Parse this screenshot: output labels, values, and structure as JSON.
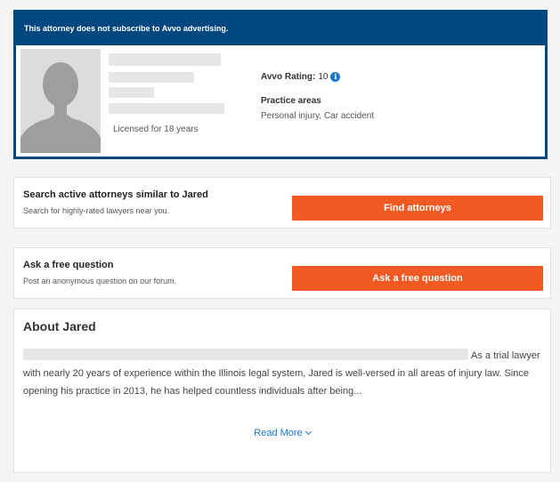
{
  "profile": {
    "ad_banner": "This attorney does not subscribe to Avvo advertising.",
    "licensed": "Licensed for 18 years",
    "rating_label": "Avvo Rating:",
    "rating_value": "10",
    "info_glyph": "i",
    "practice_areas_title": "Practice areas",
    "practice_areas": "Personal injury, Car accident"
  },
  "similar": {
    "title": "Search active attorneys similar to Jared",
    "subtitle": "Search for highly-rated lawyers near you.",
    "button": "Find attorneys"
  },
  "question": {
    "title": "Ask a free question",
    "subtitle": "Post an anonymous question on our forum.",
    "button": "Ask a free question"
  },
  "about": {
    "title": "About Jared",
    "text": "As a trial lawyer with nearly 20 years of experience within the Illinois legal system, Jared is well-versed in all areas of injury law. Since opening his practice in 2013, he has helped countless individuals after being...",
    "read_more": "Read More"
  },
  "colors": {
    "brand_blue": "#00467f",
    "cta_orange": "#f15a22",
    "link_blue": "#1877c9"
  },
  "icons": [
    "avatar-placeholder",
    "info-icon",
    "chevron-down-icon"
  ]
}
